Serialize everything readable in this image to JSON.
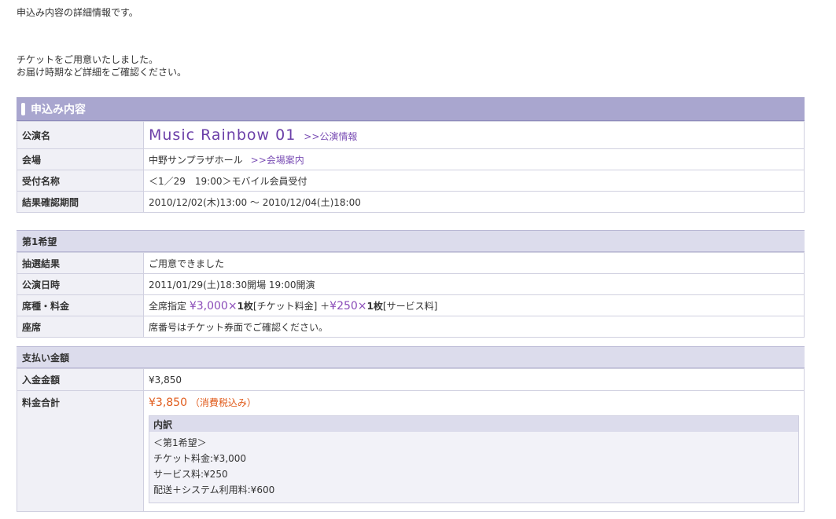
{
  "intro": {
    "line1": "申込み内容の詳細情報です。",
    "line2": "チケットをご用意いたしました。",
    "line3": "お届け時期など詳細をご確認ください。"
  },
  "application": {
    "header": "申込み内容",
    "performance_label": "公演名",
    "performance_name": "Music  Rainbow  01",
    "performance_link": ">>公演情報",
    "venue_label": "会場",
    "venue": "中野サンプラザホール",
    "venue_link": ">>会場案内",
    "reception_label": "受付名称",
    "reception": "＜1／29　19:00＞モバイル会員受付",
    "result_period_label": "結果確認期間",
    "result_period": "2010/12/02(木)13:00 ～ 2010/12/04(土)18:00"
  },
  "choice1": {
    "header": "第1希望",
    "lottery_label": "抽選結果",
    "lottery_result": "ご用意できました",
    "date_label": "公演日時",
    "date": "2011/01/29(土)18:30開場 19:00開演",
    "seat_label": "席種・料金",
    "seat_type": "全席指定",
    "ticket_price": "¥3,000",
    "ticket_qty": "×",
    "ticket_count": "1枚",
    "ticket_fee_label": "[チケット料金]",
    "plus": "＋",
    "service_price": "¥250",
    "service_qty": "×",
    "service_count": "1枚",
    "service_fee_label": "[サービス料]",
    "seat_no_label": "座席",
    "seat_no": "席番号はチケット券面でご確認ください。"
  },
  "payment": {
    "header": "支払い金額",
    "paid_label": "入金金額",
    "paid": "¥3,850",
    "total_label": "料金合計",
    "total": "¥3,850",
    "total_note": "（消費税込み）",
    "breakdown": {
      "header": "内訳",
      "line1": "＜第1希望＞",
      "line2": "チケット料金:¥3,000",
      "line3": "サービス料:¥250",
      "line4": "配送＋システム利用料:¥600"
    }
  },
  "colors": {
    "header_main": "#a9a6cf",
    "header_sub": "#dcdcec",
    "label_bg": "#f0f0f6",
    "accent_purple": "#6b3fa8",
    "total_orange": "#e05a1a"
  }
}
